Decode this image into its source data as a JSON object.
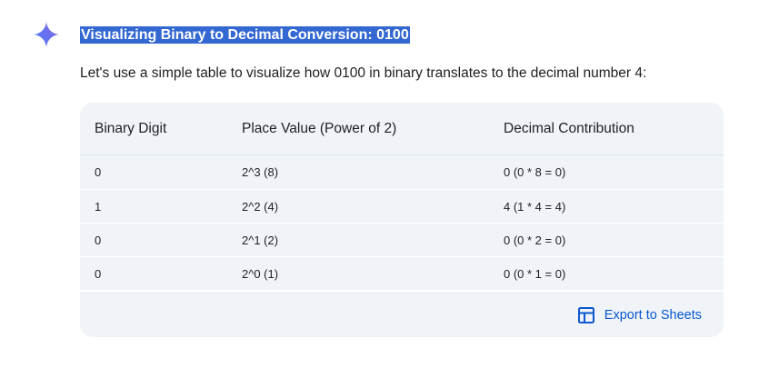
{
  "response": {
    "heading": "Visualizing Binary to Decimal Conversion: 0100",
    "intro": "Let's use a simple table to visualize how 0100 in binary translates to the decimal number 4:"
  },
  "table": {
    "headers": [
      "Binary Digit",
      "Place Value (Power of 2)",
      "Decimal Contribution"
    ],
    "rows": [
      [
        "0",
        "2^3 (8)",
        "0 (0 * 8 = 0)"
      ],
      [
        "1",
        "2^2 (4)",
        "4 (1 * 4 = 4)"
      ],
      [
        "0",
        "2^1 (2)",
        "0 (0 * 2 = 0)"
      ],
      [
        "0",
        "2^0 (1)",
        "0 (0 * 1 = 0)"
      ]
    ]
  },
  "actions": {
    "export_label": "Export to Sheets"
  },
  "icons": {
    "assistant": "sparkle-icon",
    "export": "table-icon"
  },
  "colors": {
    "selection": "#3367d1",
    "card_background": "#f0f4f9",
    "link": "#0b57d0"
  }
}
